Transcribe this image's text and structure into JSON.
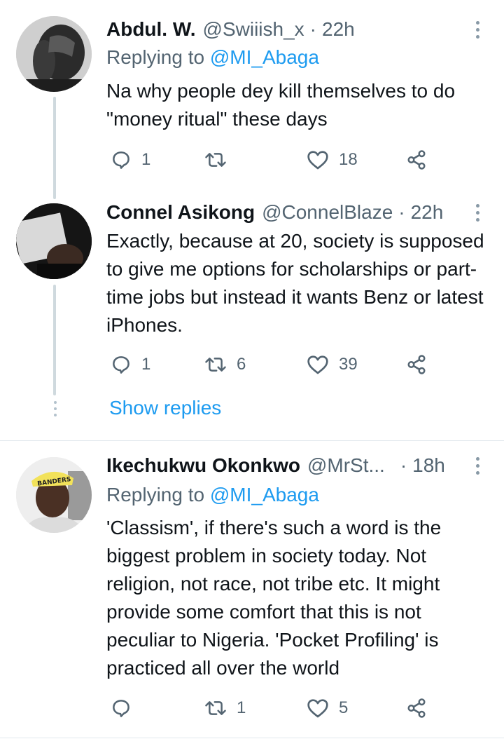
{
  "tweets": [
    {
      "name": "Abdul. W.",
      "handle": "@Swiiish_x",
      "time": "22h",
      "replying_prefix": "Replying to",
      "replying_to": "@MI_Abaga",
      "text": "Na why people dey kill themselves to do \"money ritual\" these days",
      "replies": "1",
      "retweets": "",
      "likes": "18",
      "avatar_icon": "user-photo"
    },
    {
      "name": "Connel Asikong",
      "handle": "@ConnelBlaze",
      "time": "22h",
      "text": "Exactly, because at 20, society is supposed to give me options for scholarships or part-time jobs but instead it wants Benz or latest iPhones.",
      "replies": "1",
      "retweets": "6",
      "likes": "39",
      "avatar_icon": "user-photo"
    },
    {
      "name": "Ikechukwu Okonkwo",
      "handle": "@MrSt...",
      "time": "18h",
      "replying_prefix": "Replying to",
      "replying_to": "@MI_Abaga",
      "text": "'Classism', if there's such a word is the biggest problem in society today. Not religion, not race, not tribe etc. It might provide some comfort that this is not peculiar to Nigeria. 'Pocket Profiling' is practiced all over the world",
      "replies": "",
      "retweets": "1",
      "likes": "5",
      "avatar_icon": "user-photo",
      "avatar_cap_text": "BANDERS"
    }
  ],
  "show_replies": "Show replies",
  "colors": {
    "accent": "#1d9bf0",
    "secondary_text": "#536471",
    "divider": "#e1e8ed",
    "thread_line": "#cfd9de"
  }
}
